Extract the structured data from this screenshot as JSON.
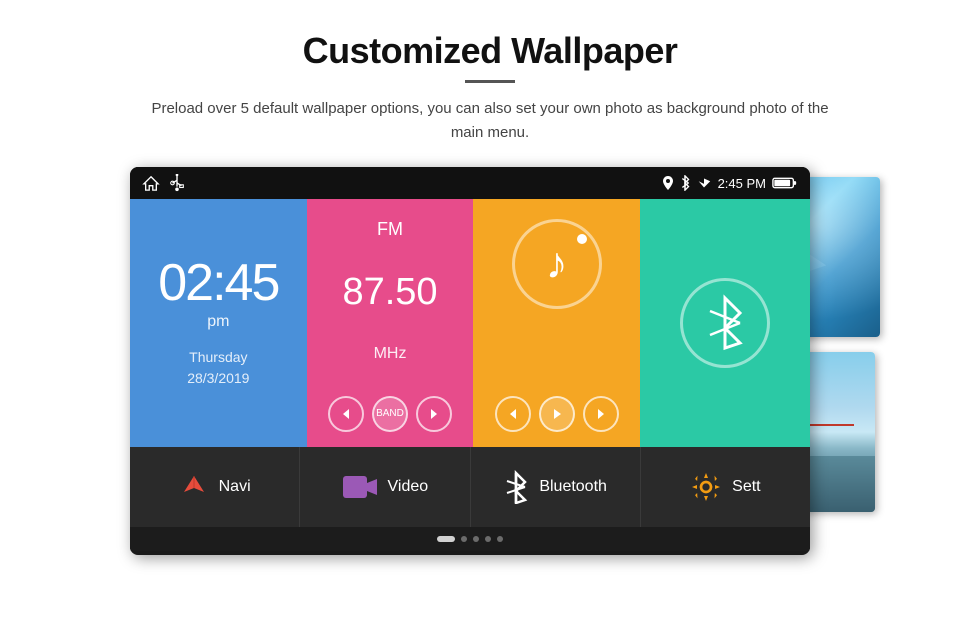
{
  "header": {
    "title": "Customized Wallpaper",
    "subtitle": "Preload over 5 default wallpaper options, you can also set your own photo as background photo of the main menu."
  },
  "status_bar": {
    "time": "2:45 PM",
    "icons": [
      "home",
      "usb",
      "location",
      "bluetooth",
      "wifi",
      "battery"
    ]
  },
  "clock_widget": {
    "time": "02:45",
    "ampm": "pm",
    "day": "Thursday",
    "date": "28/3/2019"
  },
  "fm_widget": {
    "label": "FM",
    "frequency": "87.50",
    "unit": "MHz"
  },
  "music_widget": {
    "note": "♪"
  },
  "bluetooth_widget": {
    "symbol": "⚡"
  },
  "apps": [
    {
      "id": "navi",
      "label": "Navi",
      "icon": "navigation"
    },
    {
      "id": "video",
      "label": "Video",
      "icon": "video"
    },
    {
      "id": "bluetooth",
      "label": "Bluetooth",
      "icon": "bluetooth"
    },
    {
      "id": "settings",
      "label": "Sett",
      "icon": "settings"
    }
  ],
  "dots": [
    {
      "active": true
    },
    {
      "active": false
    },
    {
      "active": false
    },
    {
      "active": false
    },
    {
      "active": false
    }
  ],
  "colors": {
    "clock_bg": "#4a90d9",
    "fm_bg": "#e74c8b",
    "music_bg": "#f5a623",
    "bt_bg": "#2bc9a5",
    "app_bar": "#2a2a2a"
  }
}
